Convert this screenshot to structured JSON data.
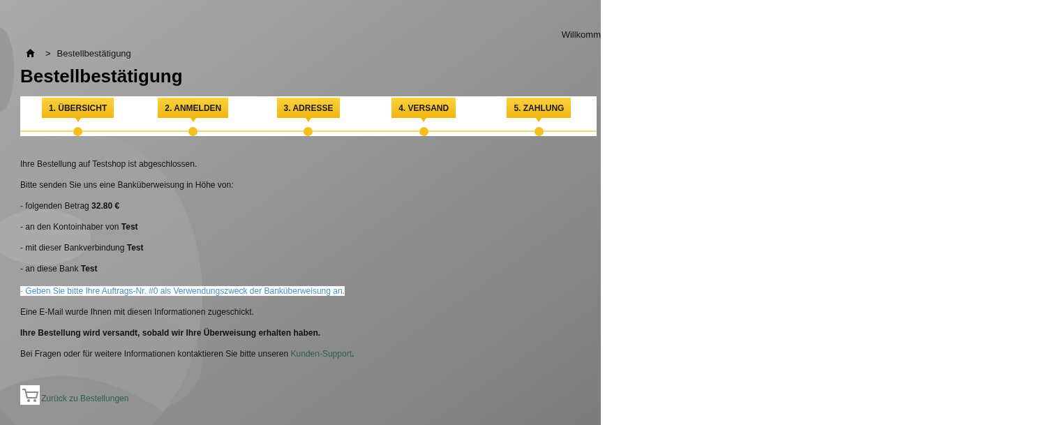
{
  "header": {
    "welcome": "Willkomm"
  },
  "breadcrumb": {
    "separator": ">",
    "current": "Bestellbestätigung"
  },
  "title": "Bestellbestätigung",
  "steps": [
    {
      "label": "1. ÜBERSICHT"
    },
    {
      "label": "2. ANMELDEN"
    },
    {
      "label": "3. ADRESSE"
    },
    {
      "label": "4. VERSAND"
    },
    {
      "label": "5. ZAHLUNG"
    }
  ],
  "paragraphs": [
    {
      "kind": "plain",
      "text": "Ihre Bestellung auf Testshop ist abgeschlossen."
    },
    {
      "kind": "plain",
      "text": "Bitte senden Sie uns eine Banküberweisung in Höhe von:"
    },
    {
      "kind": "plain",
      "text": "- folgenden Betrag **32.80 €**"
    },
    {
      "kind": "plain",
      "text": "- an den Kontoinhaber von **Test**"
    },
    {
      "kind": "plain",
      "text": "- mit dieser Bankverbindung **Test**"
    },
    {
      "kind": "plain",
      "text": "- an diese Bank **Test**"
    },
    {
      "kind": "highlight",
      "text": "- Geben Sie bitte Ihre Auftrags-Nr. #0 als Verwendungszweck der Banküberweisung an."
    },
    {
      "kind": "plain",
      "text": "Eine E-Mail wurde Ihnen mit diesen Informationen zugeschickt."
    },
    {
      "kind": "bold",
      "text": "Ihre Bestellung wird versandt, sobald wir Ihre Überweisung erhalten haben."
    },
    {
      "kind": "link",
      "text": "Bei Fragen oder für weitere Informationen kontaktieren Sie bitte unseren ",
      "link": "Kunden-Support",
      "after": "."
    }
  ],
  "back_link": "Zurück zu Bestellungen"
}
